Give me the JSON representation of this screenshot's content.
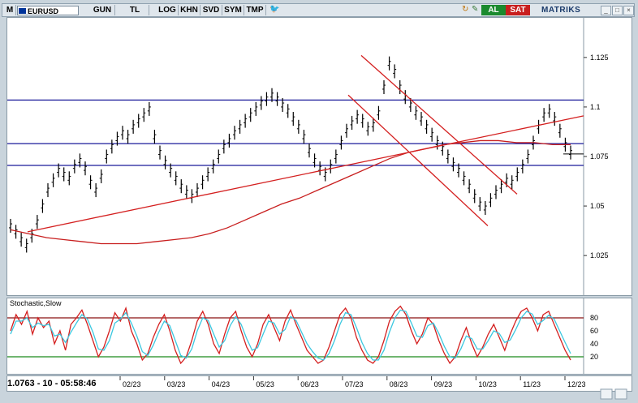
{
  "toolbar": {
    "m_label": "M",
    "symbol": "EURUSD",
    "buttons": [
      "GUN",
      "TL",
      "LOG",
      "KHN",
      "SVD",
      "SYM",
      "TMP"
    ],
    "buy_label": "AL",
    "sell_label": "SAT",
    "brand": "MATRIKS",
    "colors": {
      "buy": "#1a8a2e",
      "sell": "#c81e1e"
    }
  },
  "status": {
    "readout": "1.0763 - 10 - 05:58:46"
  },
  "stochastic": {
    "title": "Stochastic,Slow",
    "levels": [
      "80",
      "60",
      "40",
      "20"
    ]
  },
  "chart_data": [
    {
      "type": "line",
      "title": "",
      "series_style": "ohlc-bars",
      "x_tick_labels": [
        "02/23",
        "03/23",
        "04/23",
        "05/23",
        "06/23",
        "07/23",
        "08/23",
        "09/23",
        "10/23",
        "11/23",
        "12/23"
      ],
      "y_tick_labels": [
        "1.125",
        "1.1",
        "1.075",
        "1.05",
        "1.025"
      ],
      "ylim": [
        1.005,
        1.145
      ],
      "horizontal_lines": [
        1.1035,
        1.0815,
        1.0705
      ],
      "series": [
        {
          "values": [
            1.04,
            1.037,
            1.033,
            1.03,
            1.035,
            1.042,
            1.05,
            1.058,
            1.063,
            1.068,
            1.066,
            1.064,
            1.07,
            1.073,
            1.069,
            1.062,
            1.058,
            1.065,
            1.075,
            1.08,
            1.084,
            1.087,
            1.085,
            1.09,
            1.093,
            1.096,
            1.099,
            1.085,
            1.077,
            1.072,
            1.068,
            1.064,
            1.06,
            1.057,
            1.055,
            1.058,
            1.062,
            1.066,
            1.07,
            1.075,
            1.08,
            1.083,
            1.087,
            1.09,
            1.093,
            1.096,
            1.099,
            1.102,
            1.104,
            1.106,
            1.104,
            1.101,
            1.098,
            1.094,
            1.09,
            1.085,
            1.078,
            1.073,
            1.069,
            1.066,
            1.07,
            1.075,
            1.082,
            1.088,
            1.092,
            1.095,
            1.093,
            1.089,
            1.091,
            1.097,
            1.11,
            1.122,
            1.118,
            1.11,
            1.105,
            1.101,
            1.097,
            1.094,
            1.09,
            1.086,
            1.082,
            1.079,
            1.075,
            1.071,
            1.068,
            1.064,
            1.06,
            1.055,
            1.051,
            1.049,
            1.053,
            1.057,
            1.06,
            1.063,
            1.062,
            1.066,
            1.07,
            1.075,
            1.082,
            1.09,
            1.096,
            1.098,
            1.094,
            1.088,
            1.081,
            1.077
          ]
        },
        {
          "name": "",
          "values": [
            1.038,
            1.036,
            1.034,
            1.033,
            1.032,
            1.031,
            1.031,
            1.031,
            1.032,
            1.033,
            1.034,
            1.036,
            1.039,
            1.043,
            1.047,
            1.051,
            1.054,
            1.058,
            1.062,
            1.066,
            1.07,
            1.074,
            1.077,
            1.079,
            1.081,
            1.082,
            1.083,
            1.083,
            1.082,
            1.082,
            1.081,
            1.081
          ]
        }
      ]
    },
    {
      "type": "line",
      "title": "Stochastic,Slow",
      "x_tick_labels": [
        "02/23",
        "03/23",
        "04/23",
        "05/23",
        "06/23",
        "07/23",
        "08/23",
        "09/23",
        "10/23",
        "11/23",
        "12/23"
      ],
      "y_tick_labels": [
        "80",
        "60",
        "40",
        "20"
      ],
      "ylim": [
        0,
        100
      ],
      "reference_lines": [
        80,
        20
      ],
      "series": [
        {
          "values": [
            60,
            85,
            70,
            90,
            55,
            80,
            65,
            75,
            40,
            60,
            30,
            70,
            80,
            92,
            70,
            45,
            20,
            35,
            60,
            88,
            75,
            95,
            60,
            40,
            15,
            25,
            50,
            70,
            85,
            60,
            30,
            10,
            20,
            45,
            75,
            90,
            70,
            40,
            25,
            55,
            80,
            90,
            60,
            35,
            20,
            40,
            70,
            85,
            65,
            45,
            75,
            92,
            70,
            50,
            30,
            20,
            10,
            15,
            35,
            60,
            85,
            95,
            80,
            50,
            30,
            15,
            10,
            20,
            45,
            75,
            90,
            98,
            85,
            60,
            40,
            55,
            80,
            70,
            45,
            25,
            10,
            20,
            45,
            65,
            40,
            20,
            35,
            55,
            70,
            50,
            30,
            55,
            75,
            90,
            95,
            80,
            60,
            85,
            90,
            70,
            50,
            30,
            15
          ]
        },
        {
          "values": [
            55,
            75,
            75,
            80,
            65,
            72,
            68,
            70,
            52,
            55,
            42,
            58,
            72,
            85,
            78,
            58,
            32,
            30,
            45,
            72,
            78,
            88,
            72,
            52,
            28,
            22,
            38,
            58,
            75,
            68,
            45,
            22,
            18,
            32,
            60,
            80,
            76,
            55,
            35,
            45,
            68,
            82,
            70,
            48,
            30,
            34,
            55,
            75,
            72,
            55,
            62,
            82,
            76,
            58,
            40,
            28,
            18,
            15,
            25,
            45,
            70,
            88,
            85,
            65,
            42,
            25,
            15,
            15,
            30,
            58,
            80,
            92,
            90,
            72,
            52,
            50,
            68,
            72,
            56,
            36,
            20,
            18,
            32,
            52,
            48,
            32,
            32,
            45,
            60,
            56,
            42,
            46,
            62,
            80,
            90,
            86,
            70,
            76,
            84,
            78,
            60,
            42,
            25
          ]
        }
      ]
    }
  ]
}
